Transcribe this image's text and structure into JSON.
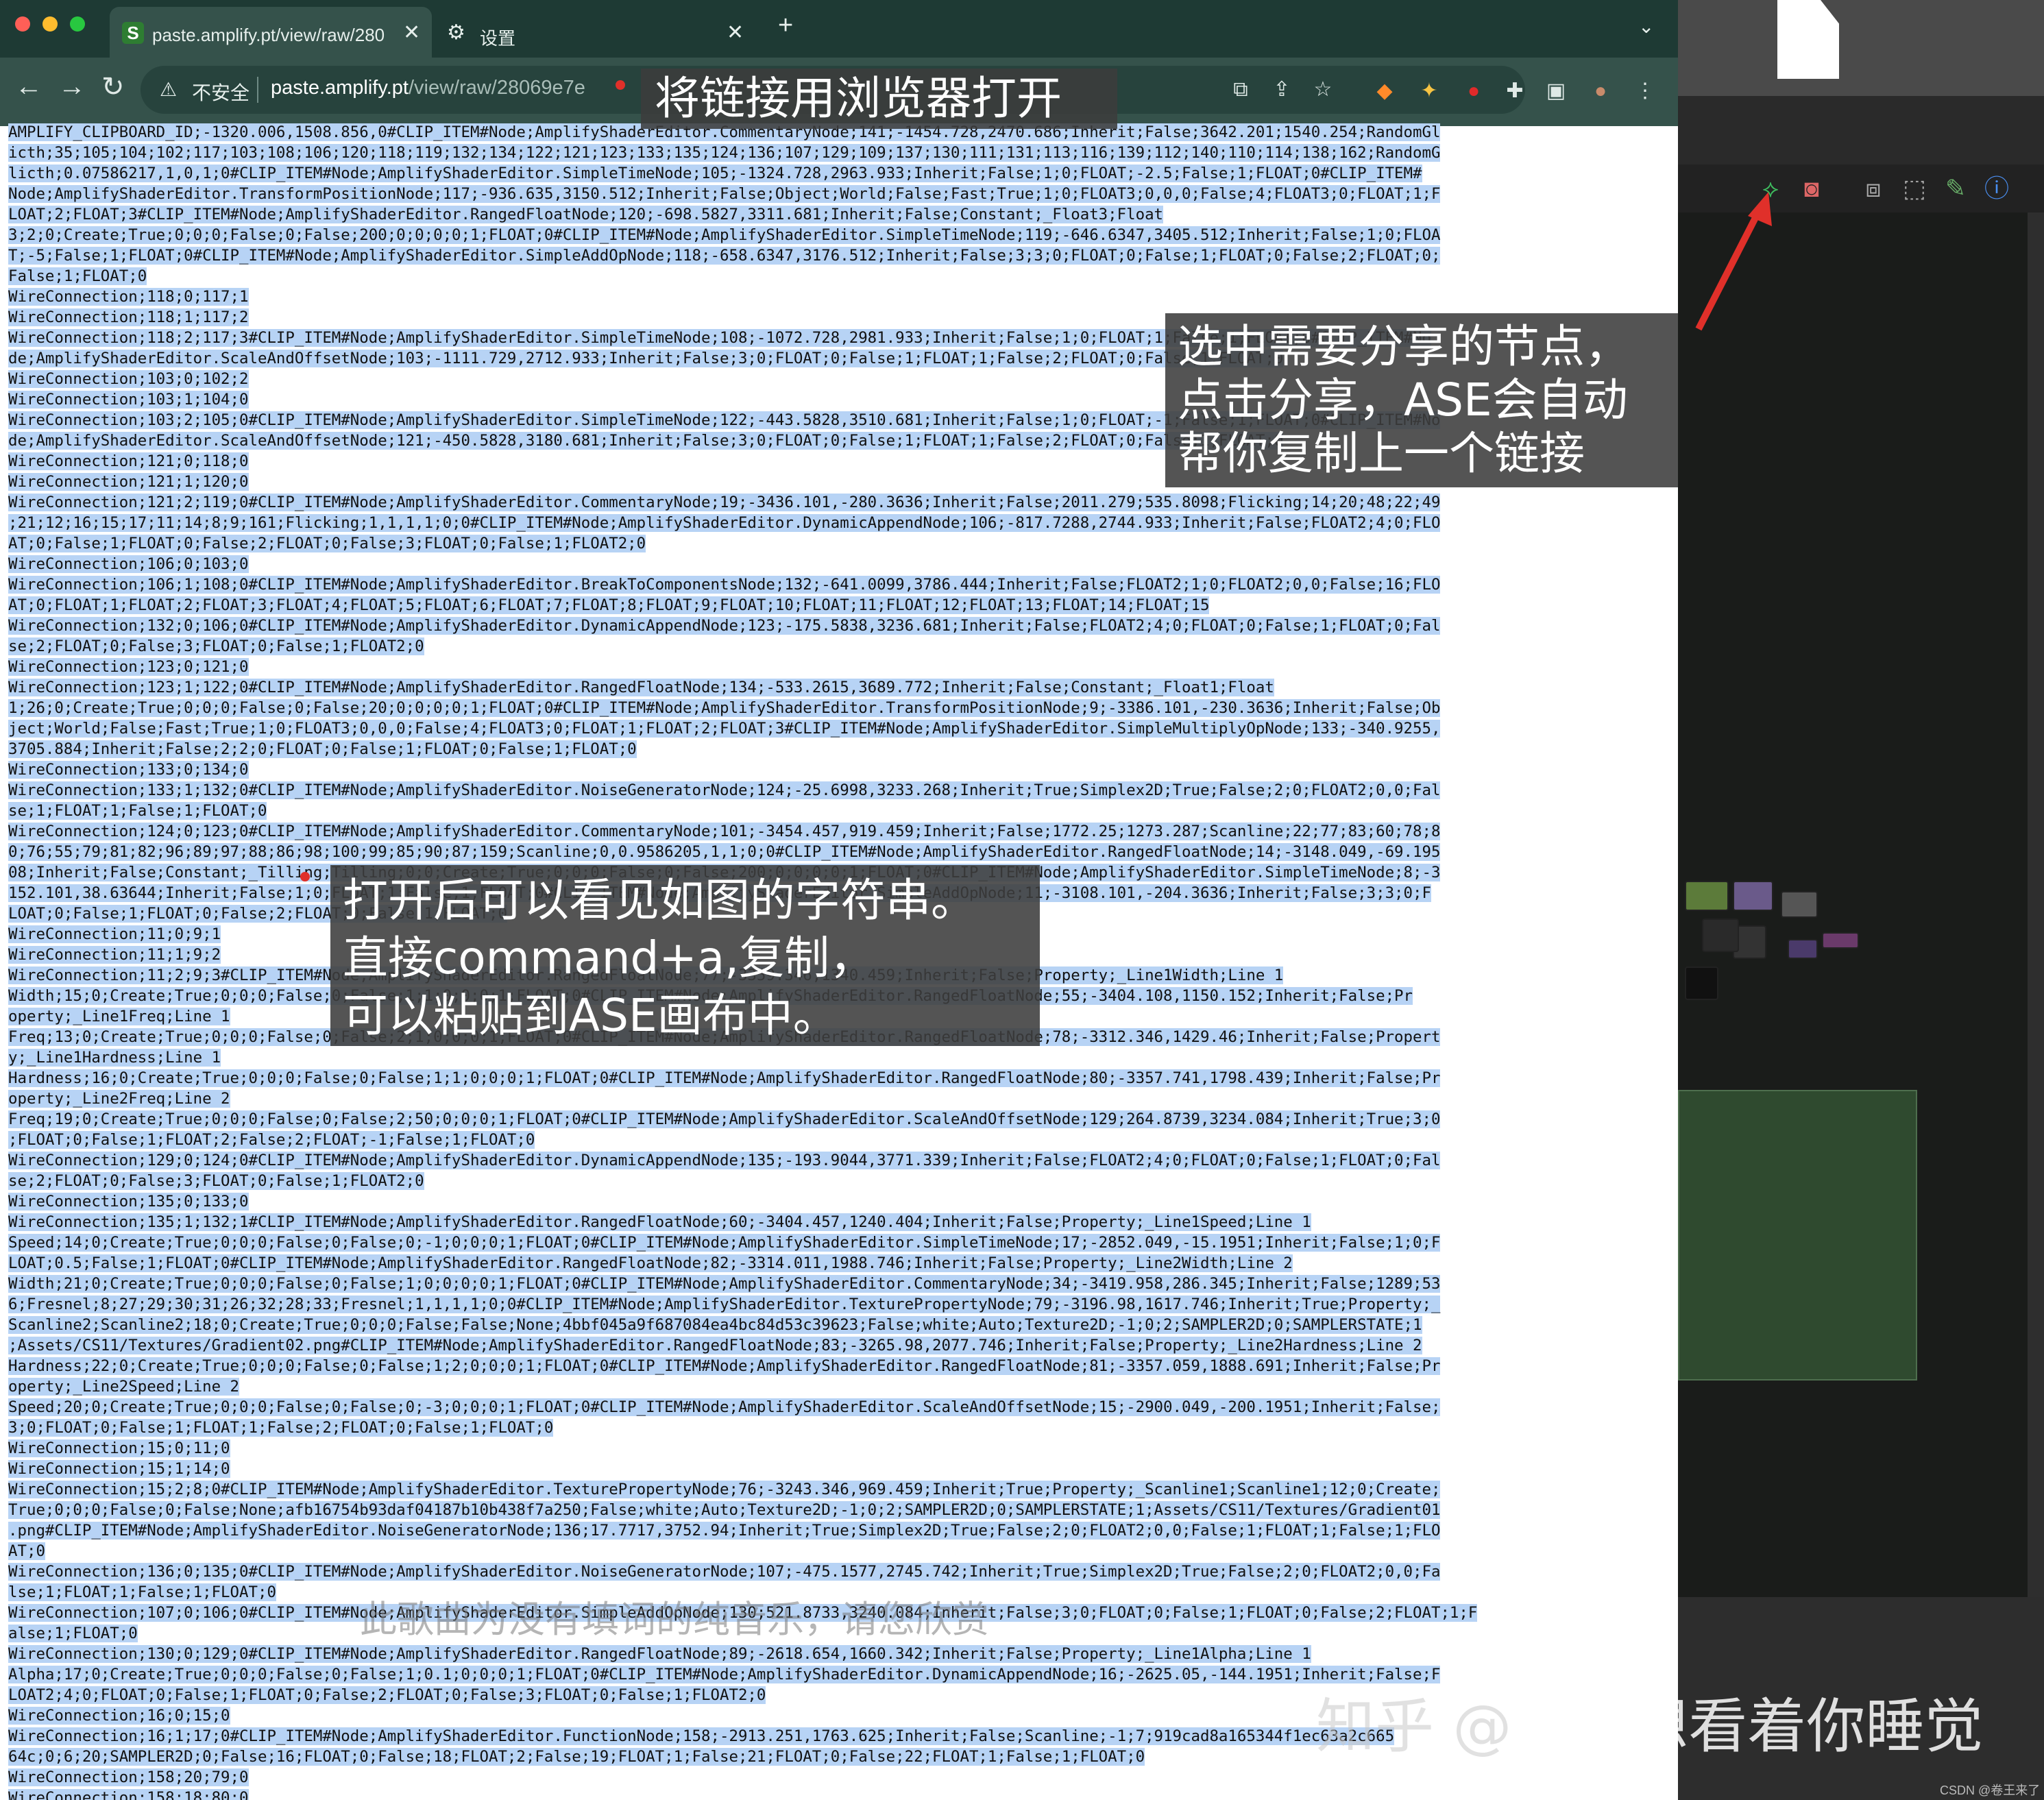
{
  "browser": {
    "tabs": [
      {
        "icon": "S",
        "title": "paste.amplify.pt/view/raw/280"
      },
      {
        "title": "设置"
      }
    ],
    "security_label": "不安全",
    "url_host": "paste.amplify.pt",
    "url_path": "/view/raw/28069e7e"
  },
  "page_lines": [
    "AMPLIFY_CLIPBOARD_ID;-1320.006,1508.856,0#CLIP_ITEM#Node;AmplifyShaderEditor.CommentaryNode;141;-1454.728,2470.686;Inherit;False;3642.201;1540.254;RandomGl",
    "icth;35;105;104;102;117;103;108;106;120;118;119;132;134;122;121;123;133;135;124;136;107;129;109;137;130;111;131;113;116;139;112;140;110;114;138;162;RandomG",
    "licth;0.07586217,1,0,1;0#CLIP_ITEM#Node;AmplifyShaderEditor.SimpleTimeNode;105;-1324.728,2963.933;Inherit;False;1;0;FLOAT;-2.5;False;1;FLOAT;0#CLIP_ITEM#",
    "Node;AmplifyShaderEditor.TransformPositionNode;117;-936.635,3150.512;Inherit;False;Object;World;False;Fast;True;1;0;FLOAT3;0,0,0;False;4;FLOAT3;0;FLOAT;1;F",
    "LOAT;2;FLOAT;3#CLIP_ITEM#Node;AmplifyShaderEditor.RangedFloatNode;120;-698.5827,3311.681;Inherit;False;Constant;_Float3;Float",
    "3;2;0;Create;True;0;0;0;False;0;False;200;0;0;0;0;1;FLOAT;0#CLIP_ITEM#Node;AmplifyShaderEditor.SimpleTimeNode;119;-646.6347,3405.512;Inherit;False;1;0;FLOA",
    "T;-5;False;1;FLOAT;0#CLIP_ITEM#Node;AmplifyShaderEditor.SimpleAddOpNode;118;-658.6347,3176.512;Inherit;False;3;3;0;FLOAT;0;False;1;FLOAT;0;False;2;FLOAT;0;",
    "False;1;FLOAT;0",
    "WireConnection;118;0;117;1",
    "WireConnection;118;1;117;2",
    "WireConnection;118;2;117;3#CLIP_ITEM#Node;AmplifyShaderEditor.SimpleTimeNode;108;-1072.728,2981.933;Inherit;False;1;0;FLOAT;1;False;1;FLOAT;0#CLIP_ITEM#No",
    "de;AmplifyShaderEditor.ScaleAndOffsetNode;103;-1111.729,2712.933;Inherit;False;3;0;FLOAT;0;False;1;FLOAT;1;False;2;FLOAT;0;False;1;FLOAT;0",
    "WireConnection;103;0;102;2",
    "WireConnection;103;1;104;0",
    "WireConnection;103;2;105;0#CLIP_ITEM#Node;AmplifyShaderEditor.SimpleTimeNode;122;-443.5828,3510.681;Inherit;False;1;0;FLOAT;-1;False;1;FLOAT;0#CLIP_ITEM#No",
    "de;AmplifyShaderEditor.ScaleAndOffsetNode;121;-450.5828,3180.681;Inherit;False;3;0;FLOAT;0;False;1;FLOAT;1;False;2;FLOAT;0;False;1;FLOAT;0",
    "WireConnection;121;0;118;0",
    "WireConnection;121;1;120;0",
    "WireConnection;121;2;119;0#CLIP_ITEM#Node;AmplifyShaderEditor.CommentaryNode;19;-3436.101,-280.3636;Inherit;False;2011.279;535.8098;Flicking;14;20;48;22;49",
    ";21;12;16;15;17;11;14;8;9;161;Flicking;1,1,1,1;0;0#CLIP_ITEM#Node;AmplifyShaderEditor.DynamicAppendNode;106;-817.7288,2744.933;Inherit;False;FLOAT2;4;0;FLO",
    "AT;0;False;1;FLOAT;0;False;2;FLOAT;0;False;3;FLOAT;0;False;1;FLOAT2;0",
    "WireConnection;106;0;103;0",
    "WireConnection;106;1;108;0#CLIP_ITEM#Node;AmplifyShaderEditor.BreakToComponentsNode;132;-641.0099,3786.444;Inherit;False;FLOAT2;1;0;FLOAT2;0,0;False;16;FLO",
    "AT;0;FLOAT;1;FLOAT;2;FLOAT;3;FLOAT;4;FLOAT;5;FLOAT;6;FLOAT;7;FLOAT;8;FLOAT;9;FLOAT;10;FLOAT;11;FLOAT;12;FLOAT;13;FLOAT;14;FLOAT;15",
    "WireConnection;132;0;106;0#CLIP_ITEM#Node;AmplifyShaderEditor.DynamicAppendNode;123;-175.5838,3236.681;Inherit;False;FLOAT2;4;0;FLOAT;0;False;1;FLOAT;0;Fal",
    "se;2;FLOAT;0;False;3;FLOAT;0;False;1;FLOAT2;0",
    "WireConnection;123;0;121;0",
    "WireConnection;123;1;122;0#CLIP_ITEM#Node;AmplifyShaderEditor.RangedFloatNode;134;-533.2615,3689.772;Inherit;False;Constant;_Float1;Float",
    "1;26;0;Create;True;0;0;0;False;0;False;20;0;0;0;0;1;FLOAT;0#CLIP_ITEM#Node;AmplifyShaderEditor.TransformPositionNode;9;-3386.101,-230.3636;Inherit;False;Ob",
    "ject;World;False;Fast;True;1;0;FLOAT3;0,0,0;False;4;FLOAT3;0;FLOAT;1;FLOAT;2;FLOAT;3#CLIP_ITEM#Node;AmplifyShaderEditor.SimpleMultiplyOpNode;133;-340.9255,",
    "3705.884;Inherit;False;2;2;0;FLOAT;0;False;1;FLOAT;0;False;1;FLOAT;0",
    "WireConnection;133;0;134;0",
    "WireConnection;133;1;132;0#CLIP_ITEM#Node;AmplifyShaderEditor.NoiseGeneratorNode;124;-25.6998,3233.268;Inherit;True;Simplex2D;True;False;2;0;FLOAT2;0,0;Fal",
    "se;1;FLOAT;1;False;1;FLOAT;0",
    "WireConnection;124;0;123;0#CLIP_ITEM#Node;AmplifyShaderEditor.CommentaryNode;101;-3454.457,919.459;Inherit;False;1772.25;1273.287;Scanline;22;77;83;60;78;8",
    "0;76;55;79;81;82;96;89;97;88;86;98;100;99;85;90;87;159;Scanline;0,0.9586205,1,1;0;0#CLIP_ITEM#Node;AmplifyShaderEditor.RangedFloatNode;14;-3148.049,-69.195",
    "08;Inherit;False;Constant;_Tilling;Tilling;0;0;Create;True;0;0;0;False;0;False;200;0;0;0;0;1;FLOAT;0#CLIP_ITEM#Node;AmplifyShaderEditor.SimpleTimeNode;8;-3",
    "152.101,38.63644;Inherit;False;1;0;FLOAT;1;False;1;FLOAT;0#CLIP_ITEM#Node;AmplifyShaderEditor.SimpleAddOpNode;11;-3108.101,-204.3636;Inherit;False;3;3;0;F",
    "LOAT;0;False;1;FLOAT;0;False;2;FLOAT;0;False;1;FLOAT;0",
    "WireConnection;11;0;9;1",
    "WireConnection;11;1;9;2",
    "WireConnection;11;2;9;3#CLIP_ITEM#Node;AmplifyShaderEditor.RangedFloatNode;77;-3359.346,1340.459;Inherit;False;Property;_Line1Width;Line 1",
    "Width;15;0;Create;True;0;0;0;False;0;False;1;1;0;0;0;1;FLOAT;0#CLIP_ITEM#Node;AmplifyShaderEditor.RangedFloatNode;55;-3404.108,1150.152;Inherit;False;Pr",
    "operty;_Line1Freq;Line 1",
    "Freq;13;0;Create;True;0;0;0;False;0;False;2;1;0;0;0;1;FLOAT;0#CLIP_ITEM#Node;AmplifyShaderEditor.RangedFloatNode;78;-3312.346,1429.46;Inherit;False;Propert",
    "y;_Line1Hardness;Line 1",
    "Hardness;16;0;Create;True;0;0;0;False;0;False;1;1;0;0;0;1;FLOAT;0#CLIP_ITEM#Node;AmplifyShaderEditor.RangedFloatNode;80;-3357.741,1798.439;Inherit;False;Pr",
    "operty;_Line2Freq;Line 2",
    "Freq;19;0;Create;True;0;0;0;False;0;False;2;50;0;0;0;1;FLOAT;0#CLIP_ITEM#Node;AmplifyShaderEditor.ScaleAndOffsetNode;129;264.8739,3234.084;Inherit;True;3;0",
    ";FLOAT;0;False;1;FLOAT;2;False;2;FLOAT;-1;False;1;FLOAT;0",
    "WireConnection;129;0;124;0#CLIP_ITEM#Node;AmplifyShaderEditor.DynamicAppendNode;135;-193.9044,3771.339;Inherit;False;FLOAT2;4;0;FLOAT;0;False;1;FLOAT;0;Fal",
    "se;2;FLOAT;0;False;3;FLOAT;0;False;1;FLOAT2;0",
    "WireConnection;135;0;133;0",
    "WireConnection;135;1;132;1#CLIP_ITEM#Node;AmplifyShaderEditor.RangedFloatNode;60;-3404.457,1240.404;Inherit;False;Property;_Line1Speed;Line 1",
    "Speed;14;0;Create;True;0;0;0;False;0;False;0;-1;0;0;0;1;FLOAT;0#CLIP_ITEM#Node;AmplifyShaderEditor.SimpleTimeNode;17;-2852.049,-15.1951;Inherit;False;1;0;F",
    "LOAT;0.5;False;1;FLOAT;0#CLIP_ITEM#Node;AmplifyShaderEditor.RangedFloatNode;82;-3314.011,1988.746;Inherit;False;Property;_Line2Width;Line 2",
    "Width;21;0;Create;True;0;0;0;False;0;False;1;0;0;0;0;1;FLOAT;0#CLIP_ITEM#Node;AmplifyShaderEditor.CommentaryNode;34;-3419.958,286.345;Inherit;False;1289;53",
    "6;Fresnel;8;27;29;30;31;26;32;28;33;Fresnel;1,1,1,1;0;0#CLIP_ITEM#Node;AmplifyShaderEditor.TexturePropertyNode;79;-3196.98,1617.746;Inherit;True;Property;_",
    "Scanline2;Scanline2;18;0;Create;True;0;0;0;False;False;None;4bbf045a9f687084ea4bc84d53c39623;False;white;Auto;Texture2D;-1;0;2;SAMPLER2D;0;SAMPLERSTATE;1",
    ";Assets/CS11/Textures/Gradient02.png#CLIP_ITEM#Node;AmplifyShaderEditor.RangedFloatNode;83;-3265.98,2077.746;Inherit;False;Property;_Line2Hardness;Line 2",
    "Hardness;22;0;Create;True;0;0;0;False;0;False;1;2;0;0;0;1;FLOAT;0#CLIP_ITEM#Node;AmplifyShaderEditor.RangedFloatNode;81;-3357.059,1888.691;Inherit;False;Pr",
    "operty;_Line2Speed;Line 2",
    "Speed;20;0;Create;True;0;0;0;False;0;False;0;-3;0;0;0;1;FLOAT;0#CLIP_ITEM#Node;AmplifyShaderEditor.ScaleAndOffsetNode;15;-2900.049,-200.1951;Inherit;False;",
    "3;0;FLOAT;0;False;1;FLOAT;1;False;2;FLOAT;0;False;1;FLOAT;0",
    "WireConnection;15;0;11;0",
    "WireConnection;15;1;14;0",
    "WireConnection;15;2;8;0#CLIP_ITEM#Node;AmplifyShaderEditor.TexturePropertyNode;76;-3243.346,969.459;Inherit;True;Property;_Scanline1;Scanline1;12;0;Create;",
    "True;0;0;0;False;0;False;None;afb16754b93daf04187b10b438f7a250;False;white;Auto;Texture2D;-1;0;2;SAMPLER2D;0;SAMPLERSTATE;1;Assets/CS11/Textures/Gradient01",
    ".png#CLIP_ITEM#Node;AmplifyShaderEditor.NoiseGeneratorNode;136;17.7717,3752.94;Inherit;True;Simplex2D;True;False;2;0;FLOAT2;0,0;False;1;FLOAT;1;False;1;FLO",
    "AT;0",
    "WireConnection;136;0;135;0#CLIP_ITEM#Node;AmplifyShaderEditor.NoiseGeneratorNode;107;-475.1577,2745.742;Inherit;True;Simplex2D;True;False;2;0;FLOAT2;0,0;Fa",
    "lse;1;FLOAT;1;False;1;FLOAT;0",
    "WireConnection;107;0;106;0#CLIP_ITEM#Node;AmplifyShaderEditor.SimpleAddOpNode;130;521.8733,3240.084;Inherit;False;3;0;FLOAT;0;False;1;FLOAT;0;False;2;FLOAT;1;F",
    "alse;1;FLOAT;0",
    "WireConnection;130;0;129;0#CLIP_ITEM#Node;AmplifyShaderEditor.RangedFloatNode;89;-2618.654,1660.342;Inherit;False;Property;_Line1Alpha;Line 1",
    "Alpha;17;0;Create;True;0;0;0;False;0;False;1;0.1;0;0;0;1;FLOAT;0#CLIP_ITEM#Node;AmplifyShaderEditor.DynamicAppendNode;16;-2625.05,-144.1951;Inherit;False;F",
    "LOAT2;4;0;FLOAT;0;False;1;FLOAT;0;False;2;FLOAT;0;False;3;FLOAT;0;False;1;FLOAT2;0",
    "WireConnection;16;0;15;0",
    "WireConnection;16;1;17;0#CLIP_ITEM#Node;AmplifyShaderEditor.FunctionNode;158;-2913.251,1763.625;Inherit;False;Scanline;-1;7;919cad8a165344f1ec63a2c665",
    "64c;0;6;20;SAMPLER2D;0;False;16;FLOAT;0;False;18;FLOAT;2;False;19;FLOAT;1;False;21;FLOAT;0;False;22;FLOAT;1;False;1;FLOAT;0",
    "WireConnection;158;20;79;0",
    "WireConnection;158;18;80;0"
  ],
  "annotations": {
    "open_link": "将链接用浏览器打开",
    "share_line1": "选中需要分享的节点，",
    "share_line2": "点击分享，ASE会自动",
    "share_line3": "帮你复制上一个链接",
    "paste_line1": "打开后可以看见如图的字符串。",
    "paste_line2": "直接command+a,复制，",
    "paste_line3": "可以粘贴到ASE画布中。"
  },
  "overlay": {
    "lyric": "此歌曲为没有填词的纯音乐，请您欣赏",
    "watermark_prefix": "知乎 @",
    "watermark_name": "我就想看着你睡觉",
    "csdn": "CSDN @卷王来了"
  },
  "colors": {
    "tab_bar": "#1e3a34",
    "toolbar": "#35524b",
    "selection": "#b7d3f5",
    "annotation_bg": "#3c3c3c",
    "arrow_red": "#e0302a"
  }
}
